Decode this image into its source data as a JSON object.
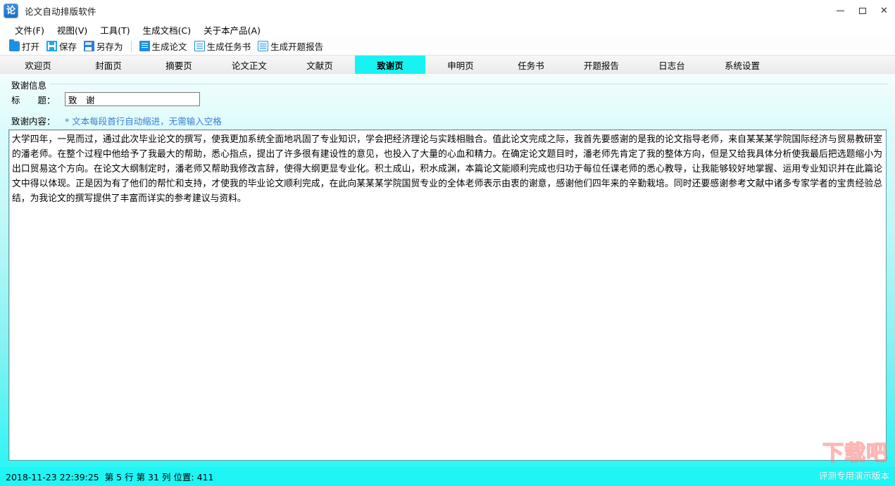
{
  "window": {
    "title": "论文自动排版软件",
    "icon_glyph": "论",
    "controls": {
      "minimize": "minimize-icon",
      "maximize": "maximize-icon",
      "close": "✕"
    }
  },
  "menubar": {
    "items": [
      {
        "label": "文件(F)",
        "name": "menu-file"
      },
      {
        "label": "视图(V)",
        "name": "menu-view"
      },
      {
        "label": "工具(T)",
        "name": "menu-tools"
      },
      {
        "label": "生成文档(C)",
        "name": "menu-generate-document"
      },
      {
        "label": "关于本产品(A)",
        "name": "menu-about"
      }
    ]
  },
  "toolbar": {
    "items": [
      {
        "label": "打开",
        "icon": "folder-open-icon",
        "name": "toolbar-open"
      },
      {
        "label": "保存",
        "icon": "floppy-save-icon",
        "name": "toolbar-save"
      },
      {
        "label": "另存为",
        "icon": "save-as-icon",
        "name": "toolbar-save-as"
      },
      {
        "label": "生成论文",
        "icon": "document-blue-icon",
        "name": "toolbar-generate-thesis"
      },
      {
        "label": "生成任务书",
        "icon": "document-outline-icon",
        "name": "toolbar-generate-task-book"
      },
      {
        "label": "生成开题报告",
        "icon": "document-pale-icon",
        "name": "toolbar-generate-proposal"
      }
    ]
  },
  "tabs": {
    "active_index": 5,
    "items": [
      {
        "label": "欢迎页",
        "name": "tab-welcome"
      },
      {
        "label": "封面页",
        "name": "tab-cover"
      },
      {
        "label": "摘要页",
        "name": "tab-abstract"
      },
      {
        "label": "论文正文",
        "name": "tab-body"
      },
      {
        "label": "文献页",
        "name": "tab-references"
      },
      {
        "label": "致谢页",
        "name": "tab-acknowledgement"
      },
      {
        "label": "申明页",
        "name": "tab-declaration"
      },
      {
        "label": "任务书",
        "name": "tab-task-book"
      },
      {
        "label": "开题报告",
        "name": "tab-proposal"
      },
      {
        "label": "日志台",
        "name": "tab-log-console"
      },
      {
        "label": "系统设置",
        "name": "tab-system-settings"
      }
    ]
  },
  "form": {
    "group_label": "致谢信息",
    "title_label": "标　　题：",
    "title_value": "致　谢",
    "title_placeholder": "",
    "content_label": "致谢内容：",
    "content_hint": "* 文本每段首行自动缩进，无需输入空格",
    "content_value": "大学四年，一晃而过，通过此次毕业论文的撰写，使我更加系统全面地巩固了专业知识，学会把经济理论与实践相融合。值此论文完成之际，我首先要感谢的是我的论文指导老师，来自某某某学院国际经济与贸易教研室的潘老师。在整个过程中他给予了我最大的帮助，悉心指点，提出了许多很有建设性的意见，也投入了大量的心血和精力。在确定论文题目时，潘老师先肯定了我的整体方向，但是又给我具体分析使我最后把选题缩小为出口贸易这个方向。在论文大纲制定时，潘老师又帮助我修改言辞，使得大纲更显专业化。积土成山，积水成渊，本篇论文能顺利完成也归功于每位任课老师的悉心教导，让我能够较好地掌握、运用专业知识并在此篇论文中得以体现。正是因为有了他们的帮忙和支持，才使我的毕业论文顺利完成，在此向某某某学院国贸专业的全体老师表示由衷的谢意，感谢他们四年来的辛勤栽培。同时还要感谢参考文献中诸多专家学者的宝贵经验总结，为我论文的撰写提供了丰富而详实的参考建议与资料。"
  },
  "statusbar": {
    "text": "2018-11-23 22:39:25  第 5 行 第 31 列 位置: 411"
  },
  "watermark": {
    "logo": "下载吧",
    "subtitle": "评测专用演示版本"
  },
  "colors": {
    "accent_cyan": "#18f2f2",
    "status_cyan": "#1ff5f5",
    "hint_blue": "#3a7fd5",
    "icon_blue": "#1f8fe0"
  }
}
